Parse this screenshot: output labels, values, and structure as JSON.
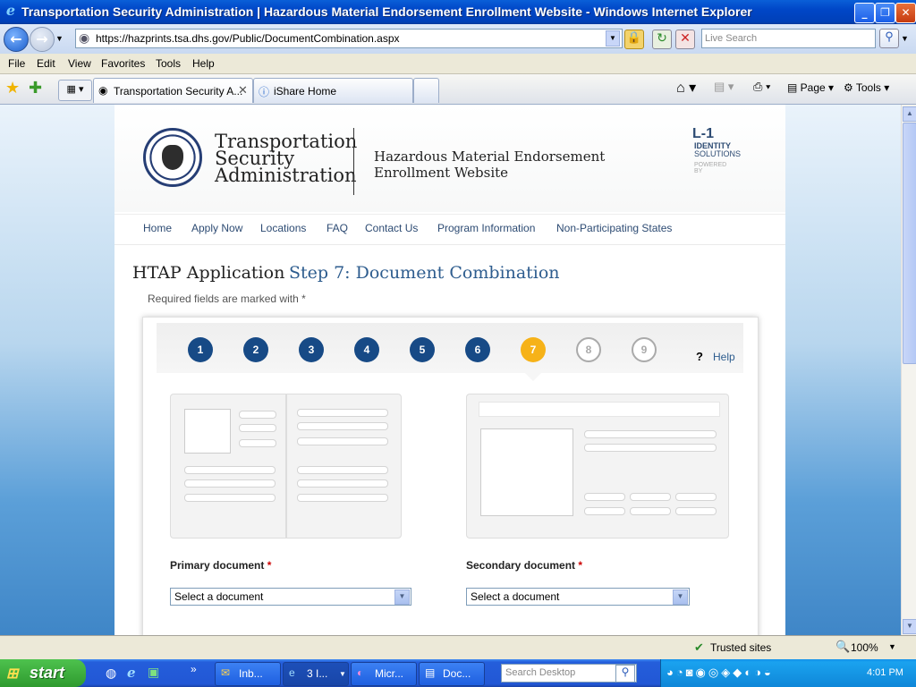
{
  "window": {
    "title": "Transportation Security Administration | Hazardous Material Endorsement Enrollment Website - Windows Internet Explorer"
  },
  "address": {
    "url": "https://hazprints.tsa.dhs.gov/Public/DocumentCombination.aspx",
    "search_placeholder": "Live Search"
  },
  "menu": [
    "File",
    "Edit",
    "View",
    "Favorites",
    "Tools",
    "Help"
  ],
  "tabs": [
    {
      "label": "Transportation Security A..."
    },
    {
      "label": "iShare Home"
    }
  ],
  "command_bar": {
    "page": "Page",
    "tools": "Tools"
  },
  "header": {
    "agency_line1": "Transportation",
    "agency_line2": "Security",
    "agency_line3": "Administration",
    "site_line1": "Hazardous Material Endorsement",
    "site_line2": "Enrollment Website",
    "partner_logo": "L-1",
    "partner_line1": "IDENTITY",
    "partner_line2": "SOLUTIONS",
    "partner_powered": "POWERED BY"
  },
  "nav": [
    "Home",
    "Apply Now",
    "Locations",
    "FAQ",
    "Contact Us",
    "Program Information",
    "Non-Participating States"
  ],
  "page": {
    "title": "HTAP Application",
    "step_title": "Step 7: Document Combination",
    "required_note": "Required fields are marked with *"
  },
  "steps": [
    "1",
    "2",
    "3",
    "4",
    "5",
    "6",
    "7",
    "8",
    "9"
  ],
  "help": {
    "symbol": "?",
    "label": "Help"
  },
  "form": {
    "primary_label": "Primary document",
    "secondary_label": "Secondary document",
    "required_mark": "*",
    "primary_value": "Select a document",
    "secondary_value": "Select a document"
  },
  "status": {
    "zone": "Trusted sites",
    "zoom": "100%"
  },
  "taskbar": {
    "start": "start",
    "buttons": [
      "Inb...",
      "3 I...",
      "Micr...",
      "Doc..."
    ],
    "search_placeholder": "Search Desktop",
    "time": "4:01 PM"
  }
}
